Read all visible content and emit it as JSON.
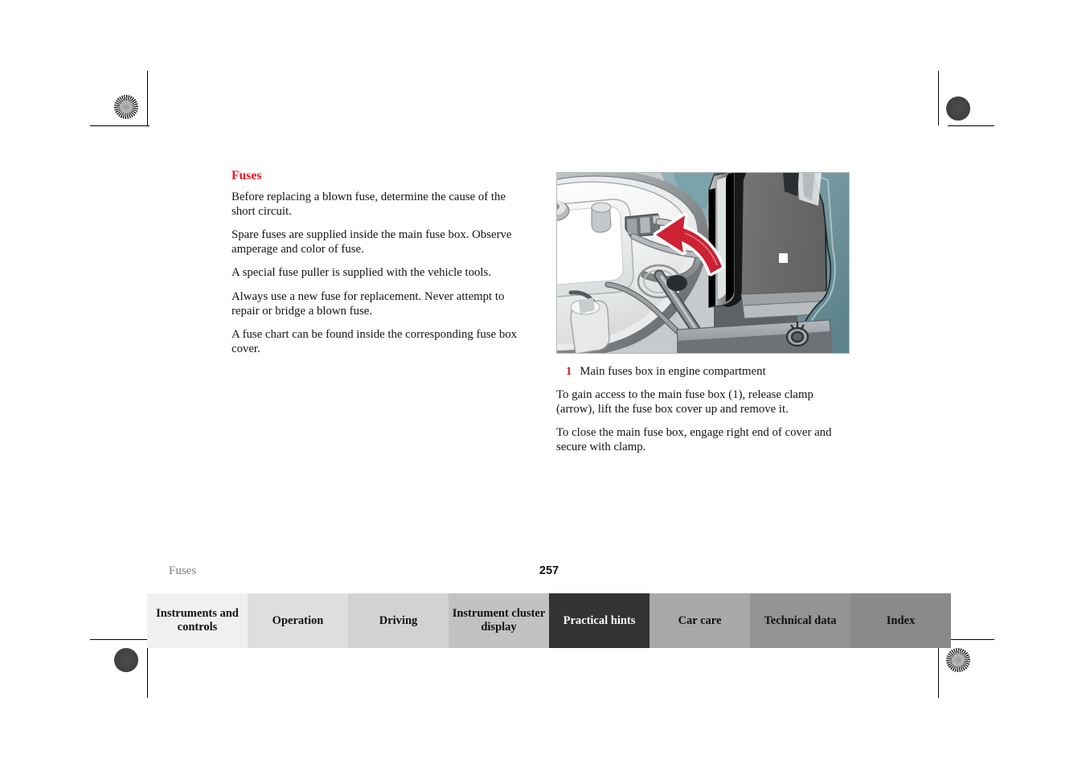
{
  "document": {
    "type": "owners-manual-page",
    "page_number": "257",
    "running_footer": "Fuses"
  },
  "content": {
    "heading": "Fuses",
    "paragraphs": [
      "Before replacing a blown fuse, determine the cause of the short circuit.",
      "Spare fuses are supplied inside the main fuse box. Observe amperage and color of fuse.",
      "A special fuse puller is supplied with the vehicle tools.",
      "Always use a new fuse for replacement. Never attempt to repair or bridge a blown fuse.",
      "A fuse chart can be found inside the corresponding fuse box cover."
    ]
  },
  "figure": {
    "caption_number": "1",
    "caption_text": "Main fuses box in engine compartment",
    "description": "Engine compartment photo-illustration showing the main fuse box with cover, a red curved arrow pointing left at the retaining clamp",
    "paragraphs": [
      "To gain access to the main fuse box (1), release clamp (arrow), lift the fuse box cover up and remove it.",
      "To close the main fuse box, engage right end of cover and secure with clamp."
    ]
  },
  "tabs": [
    {
      "label": "Instruments and controls",
      "color": "#f0f0f0",
      "active": false
    },
    {
      "label": "Operation",
      "color": "#dedede",
      "active": false
    },
    {
      "label": "Driving",
      "color": "#d2d2d2",
      "active": false
    },
    {
      "label": "Instrument cluster display",
      "color": "#c2c2c2",
      "active": false
    },
    {
      "label": "Practical hints",
      "color": "#333333",
      "active": true
    },
    {
      "label": "Car care",
      "color": "#a9a9a9",
      "active": false
    },
    {
      "label": "Technical data",
      "color": "#949494",
      "active": false
    },
    {
      "label": "Index",
      "color": "#8a8a8a",
      "active": false
    }
  ],
  "colors": {
    "heading_red": "#ee1122",
    "caption_red": "#e01020",
    "arrow_red": "#cc2233",
    "active_tab": "#333333",
    "footer_label_gray": "#7d7d7d",
    "fuse_box_gray": "#6b6b6b",
    "background_teal": "#6b8e96"
  }
}
